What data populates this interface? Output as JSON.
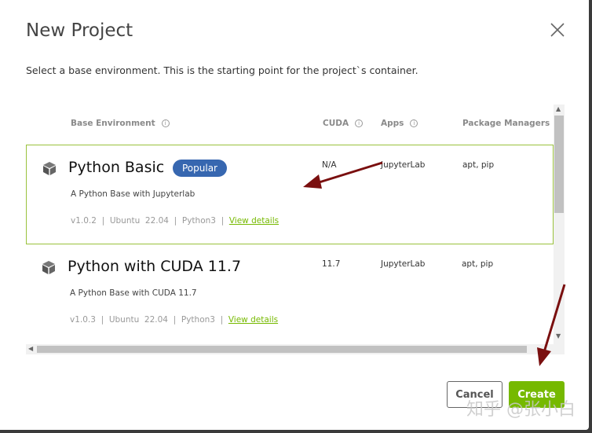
{
  "dialog": {
    "title": "New Project",
    "subtitle": "Select a base environment. This is the starting point for the project`s container."
  },
  "table": {
    "headers": {
      "base": "Base Environment",
      "cuda": "CUDA",
      "apps": "Apps",
      "pkg": "Package Managers"
    },
    "rows": [
      {
        "name": "Python Basic",
        "badge": "Popular",
        "desc": "A Python Base with Jupyterlab",
        "meta": "v1.0.2  |  Ubuntu  22.04  |  Python3  |  ",
        "link": "View details",
        "cuda": "N/A",
        "apps": "JupyterLab",
        "pkg": "apt, pip"
      },
      {
        "name": "Python with CUDA 11.7",
        "desc": "A Python Base with CUDA 11.7",
        "meta": "v1.0.3  |  Ubuntu  22.04  |  Python3  |  ",
        "link": "View details",
        "cuda": "11.7",
        "apps": "JupyterLab",
        "pkg": "apt, pip"
      }
    ]
  },
  "buttons": {
    "cancel": "Cancel",
    "create": "Create"
  },
  "watermark": "知乎 @张小白",
  "colors": {
    "accent": "#76b900",
    "badge": "#3767b0",
    "arrow": "#7a0f0f"
  }
}
